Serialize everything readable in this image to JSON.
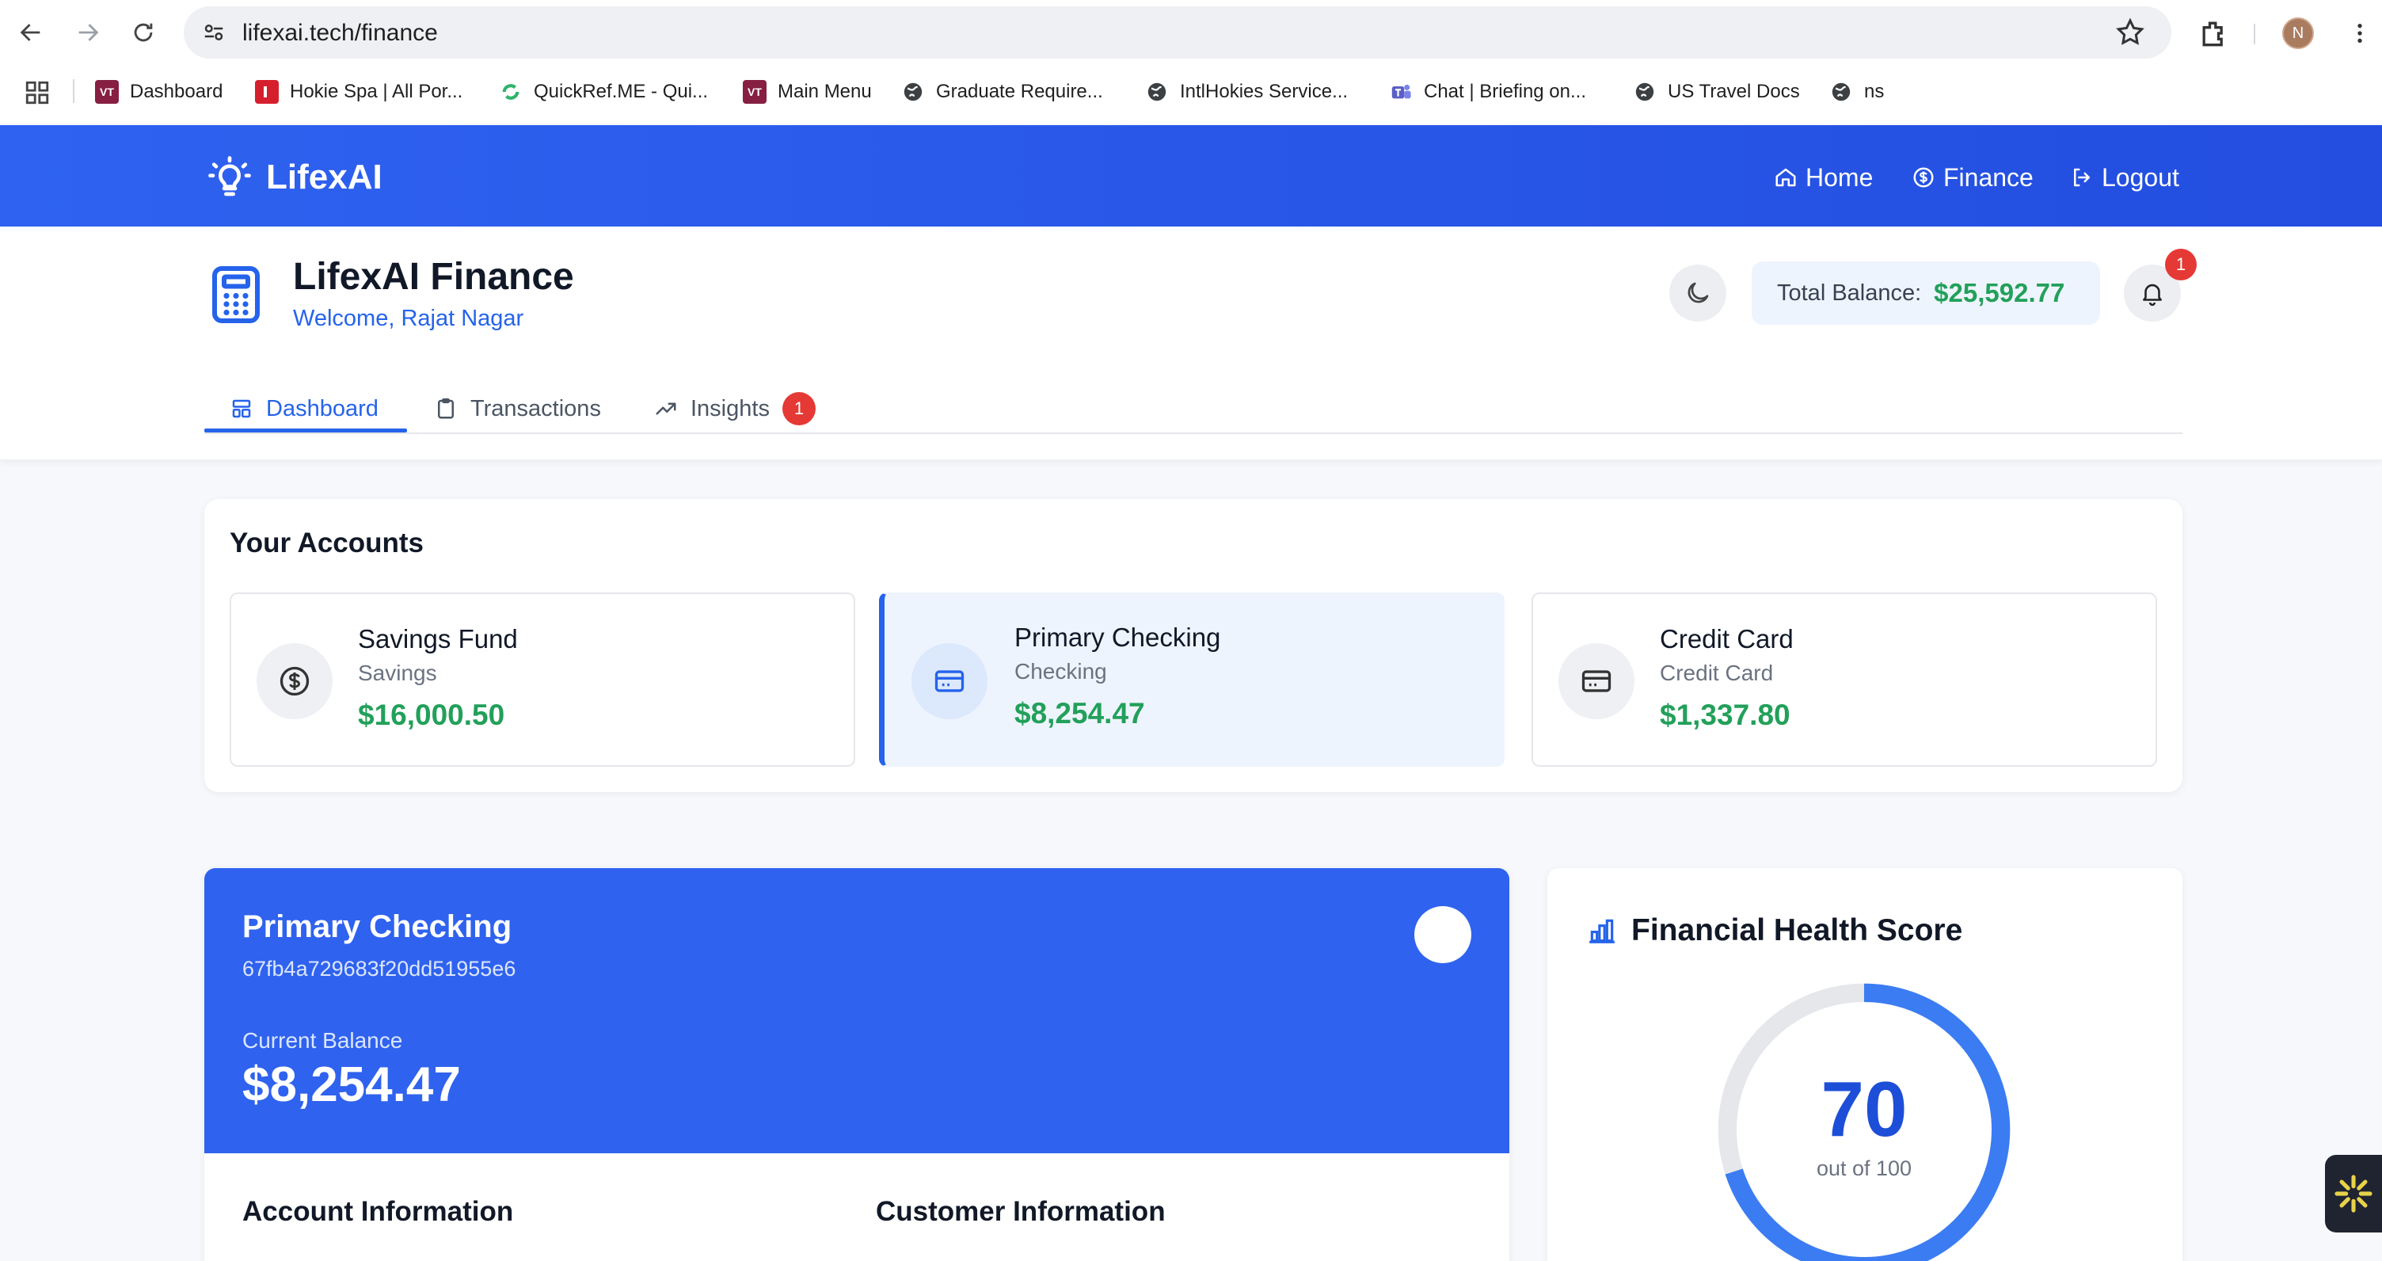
{
  "browser": {
    "url": "lifexai.tech/finance",
    "profile_initial": "N",
    "bookmarks": [
      {
        "label": "Dashboard",
        "icon": "vt-icon"
      },
      {
        "label": "Hokie Spa | All Por...",
        "icon": "hokie-icon"
      },
      {
        "label": "QuickRef.ME - Qui...",
        "icon": "quickref-icon"
      },
      {
        "label": "Main Menu",
        "icon": "vt-icon"
      },
      {
        "label": "Graduate Require...",
        "icon": "globe-icon"
      },
      {
        "label": "IntlHokies Service...",
        "icon": "globe-icon"
      },
      {
        "label": "Chat | Briefing on...",
        "icon": "teams-icon"
      },
      {
        "label": "US Travel Docs",
        "icon": "globe-icon"
      },
      {
        "label": "ns",
        "icon": "globe-icon"
      }
    ]
  },
  "app": {
    "brand": "LifexAI",
    "nav": [
      {
        "label": "Home",
        "icon": "home-icon"
      },
      {
        "label": "Finance",
        "icon": "dollar-circle-icon"
      },
      {
        "label": "Logout",
        "icon": "logout-icon"
      }
    ],
    "accent": "#2563eb",
    "positive": "#22a05a",
    "badge": "#e53935"
  },
  "finance": {
    "title": "LifexAI Finance",
    "welcome": "Welcome, Rajat Nagar",
    "total_balance_label": "Total Balance:",
    "total_balance": "$25,592.77",
    "notification_count": "1",
    "tabs": [
      {
        "label": "Dashboard",
        "icon": "dashboard-icon",
        "active": true
      },
      {
        "label": "Transactions",
        "icon": "clipboard-icon",
        "active": false
      },
      {
        "label": "Insights",
        "icon": "trending-icon",
        "active": false,
        "badge": "1"
      }
    ]
  },
  "accounts": {
    "title": "Your Accounts",
    "items": [
      {
        "name": "Savings Fund",
        "type": "Savings",
        "balance": "$16,000.50",
        "icon": "dollar-circle-icon",
        "selected": false
      },
      {
        "name": "Primary Checking",
        "type": "Checking",
        "balance": "$8,254.47",
        "icon": "card-icon",
        "selected": true
      },
      {
        "name": "Credit Card",
        "type": "Credit Card",
        "balance": "$1,337.80",
        "icon": "card-icon",
        "selected": false
      }
    ]
  },
  "detail": {
    "name": "Primary Checking",
    "account_id": "67fb4a729683f20dd51955e6",
    "current_balance_label": "Current Balance",
    "current_balance": "$8,254.47",
    "section_left": "Account Information",
    "section_right": "Customer Information"
  },
  "health": {
    "title": "Financial Health Score",
    "score": "70",
    "score_value": 70,
    "score_max": 100,
    "subtitle": "out of 100"
  }
}
